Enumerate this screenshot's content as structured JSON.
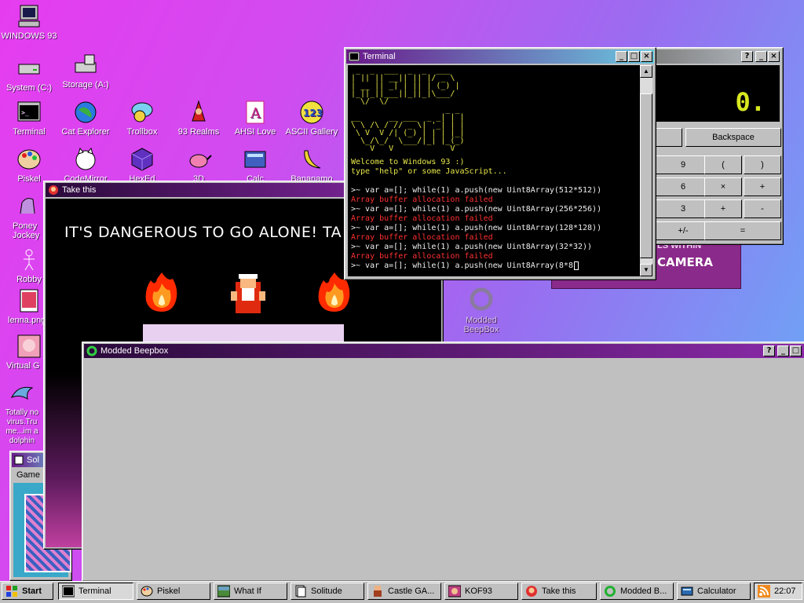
{
  "desktop": {
    "icons": [
      {
        "label": "WINDOWS 93"
      },
      {
        "label": "System (C:)"
      },
      {
        "label": "Storage (A:)"
      },
      {
        "label": "Terminal"
      },
      {
        "label": "Cat Explorer"
      },
      {
        "label": "Trollbox"
      },
      {
        "label": "93 Realms"
      },
      {
        "label": "AHSI Love"
      },
      {
        "label": "ASCII Gallery"
      },
      {
        "label": "Piskel"
      },
      {
        "label": "CodeMirror"
      },
      {
        "label": "HexEd"
      },
      {
        "label": "3D"
      },
      {
        "label": "Calc"
      },
      {
        "label": "Bananamo"
      },
      {
        "label": "Poney Jockey"
      },
      {
        "label": "Robby"
      },
      {
        "label": "lenna.png"
      },
      {
        "label": "Virtual G"
      },
      {
        "label": "Totally no virus.Tru me...im a dolphin"
      },
      {
        "label": "Modded BeepBox"
      }
    ]
  },
  "terminal": {
    "title": "Terminal",
    "ascii_lines": [
      " _  _  ___  _  _  ___ ",
      "| || || __|| || |/ _ \\",
      "| __ || _| | || | (_) |",
      "|_||_||___||_||_|\\___/",
      "  \\/  \\/              ",
      "                    _ _ ",
      "__      __ ___  _ _| | |",
      "\\ \\ /\\ / // _ \\| '_| | |",
      " \\ V  V /| (_) | | | |_|",
      "  \\_/\\_/  \\___/|_| |_(_)",
      "    V   V            V  "
    ],
    "welcome": "Welcome to Windows 93 :)",
    "help": "type \"help\" or some JavaScript...",
    "lines": [
      {
        "cmd": ">~ var a=[]; while(1) a.push(new Uint8Array(512*512))",
        "err": "Array buffer allocation failed"
      },
      {
        "cmd": ">~ var a=[]; while(1) a.push(new Uint8Array(256*256))",
        "err": "Array buffer allocation failed"
      },
      {
        "cmd": ">~ var a=[]; while(1) a.push(new Uint8Array(128*128))",
        "err": "Array buffer allocation failed"
      },
      {
        "cmd": ">~ var a=[]; while(1) a.push(new Uint8Array(32*32))",
        "err": "Array buffer allocation failed"
      }
    ],
    "current": ">~ var a=[]; while(1) a.push(new Uint8Array(8*8"
  },
  "calculator": {
    "display": "0.",
    "backspace": "Backspace",
    "keys": [
      "9",
      "(",
      ")",
      "6",
      "×",
      "+",
      "3",
      "+",
      "-",
      "+/-",
      "="
    ]
  },
  "take_this": {
    "title": "Take this",
    "caption": "IT'S DANGEROUS TO GO ALONE! TA"
  },
  "beepbox_window": {
    "title": "Modded Beepbox"
  },
  "poster": {
    "text": "CAMERA",
    "subtext": "LS WITHIN"
  },
  "solitude": {
    "title": "Sol",
    "menu": "Game"
  },
  "taskbar": {
    "start": "Start",
    "tasks": [
      "Terminal",
      "Piskel",
      "What If",
      "Solitude",
      "Castle GA...",
      "KOF93",
      "Take this",
      "Modded B...",
      "Calculator"
    ],
    "clock": "22:07"
  },
  "colors": {
    "accent_title_start": "#6a1a8a",
    "accent_title_end": "#6ac8e0",
    "terminal_bg": "#000000",
    "terminal_text": "#e6e64a",
    "terminal_error": "#ff3030"
  }
}
